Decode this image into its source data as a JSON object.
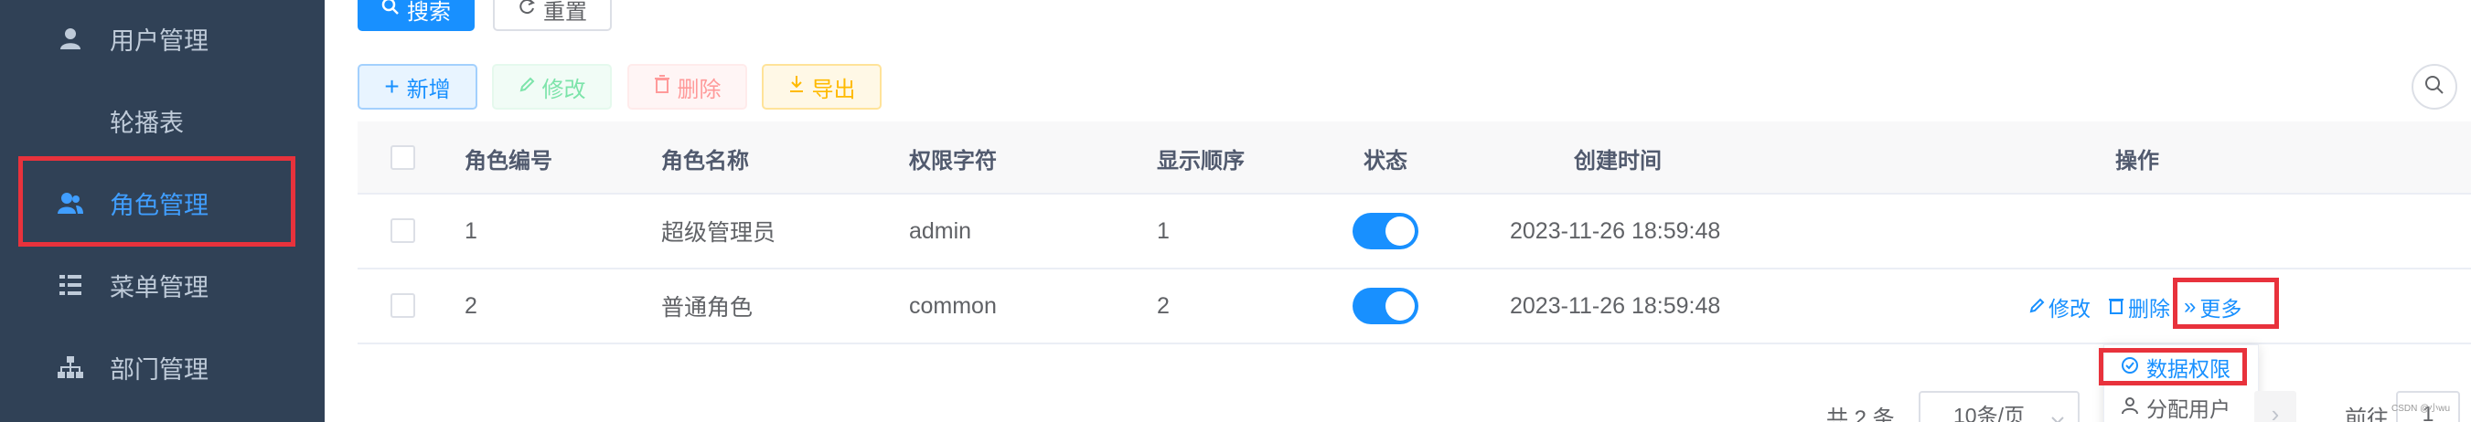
{
  "sidebar": {
    "items": [
      {
        "label": "用户管理",
        "icon": "user-icon"
      },
      {
        "label": "轮播表",
        "icon": ""
      },
      {
        "label": "角色管理",
        "icon": "peoples-icon"
      },
      {
        "label": "菜单管理",
        "icon": "tree-table-icon"
      },
      {
        "label": "部门管理",
        "icon": "tree-icon"
      }
    ]
  },
  "search": {
    "search_label": "搜索",
    "reset_label": "重置"
  },
  "toolbar": {
    "add": "新增",
    "edit": "修改",
    "delete": "删除",
    "export": "导出"
  },
  "table": {
    "columns": [
      "角色编号",
      "角色名称",
      "权限字符",
      "显示顺序",
      "状态",
      "创建时间",
      "操作"
    ],
    "rows": [
      {
        "id": "1",
        "name": "超级管理员",
        "key": "admin",
        "sort": "1",
        "status": true,
        "created": "2023-11-26 18:59:48"
      },
      {
        "id": "2",
        "name": "普通角色",
        "key": "common",
        "sort": "2",
        "status": true,
        "created": "2023-11-26 18:59:48"
      }
    ],
    "actions": {
      "edit": "修改",
      "delete": "删除",
      "more": "更多"
    }
  },
  "more_menu": {
    "items": [
      "数据权限",
      "分配用户"
    ]
  },
  "pagination": {
    "total": "共 2 条",
    "page_size": "10条/页",
    "goto": "前往",
    "page": "1"
  },
  "watermark": "CSDN @小wu",
  "colors": {
    "primary": "#1890ff",
    "sidebar_bg": "#304156",
    "highlight_red": "#e8323c"
  }
}
